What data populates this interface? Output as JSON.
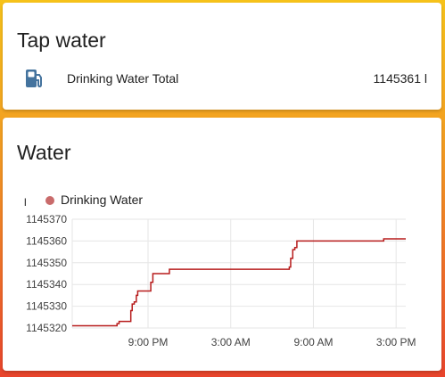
{
  "tap_card": {
    "title": "Tap water",
    "entity": {
      "icon": "gas-pump-icon",
      "name": "Drinking Water Total",
      "state": "1145361 l"
    }
  },
  "water_card": {
    "title": "Water",
    "unit": "l"
  },
  "colors": {
    "accent_icon": "#44739e",
    "series": "#b71c1c",
    "legend_dot": "#c96b6b"
  },
  "chart_data": {
    "type": "line",
    "title": "",
    "xlabel": "",
    "ylabel": "l",
    "legend_position": "top-left",
    "grid": true,
    "ylim": [
      1145320,
      1145370
    ],
    "xlim": [
      -4.0,
      20.2
    ],
    "y_ticks": [
      "1145370",
      "1145360",
      "1145350",
      "1145340",
      "1145330",
      "1145320"
    ],
    "y_tick_values": [
      1145370,
      1145360,
      1145350,
      1145340,
      1145330,
      1145320
    ],
    "x_ticks": [
      "9:00 PM",
      "3:00 AM",
      "9:00 AM",
      "3:00 PM"
    ],
    "x_tick_values": [
      1.5,
      7.5,
      13.5,
      19.5
    ],
    "series": [
      {
        "name": "Drinking Water",
        "step": true,
        "points": [
          [
            -4.0,
            1145321
          ],
          [
            -0.85,
            1145321
          ],
          [
            -0.75,
            1145322
          ],
          [
            -0.6,
            1145323
          ],
          [
            0.2,
            1145323
          ],
          [
            0.25,
            1145328
          ],
          [
            0.35,
            1145331
          ],
          [
            0.5,
            1145332
          ],
          [
            0.65,
            1145335
          ],
          [
            0.75,
            1145337
          ],
          [
            1.55,
            1145337
          ],
          [
            1.7,
            1145341
          ],
          [
            1.85,
            1145345
          ],
          [
            2.9,
            1145345
          ],
          [
            3.05,
            1145347
          ],
          [
            11.55,
            1145347
          ],
          [
            11.75,
            1145348
          ],
          [
            11.85,
            1145352
          ],
          [
            12.0,
            1145356
          ],
          [
            12.15,
            1145357
          ],
          [
            12.3,
            1145360
          ],
          [
            18.5,
            1145360
          ],
          [
            18.6,
            1145361
          ],
          [
            20.2,
            1145361
          ]
        ]
      }
    ]
  }
}
